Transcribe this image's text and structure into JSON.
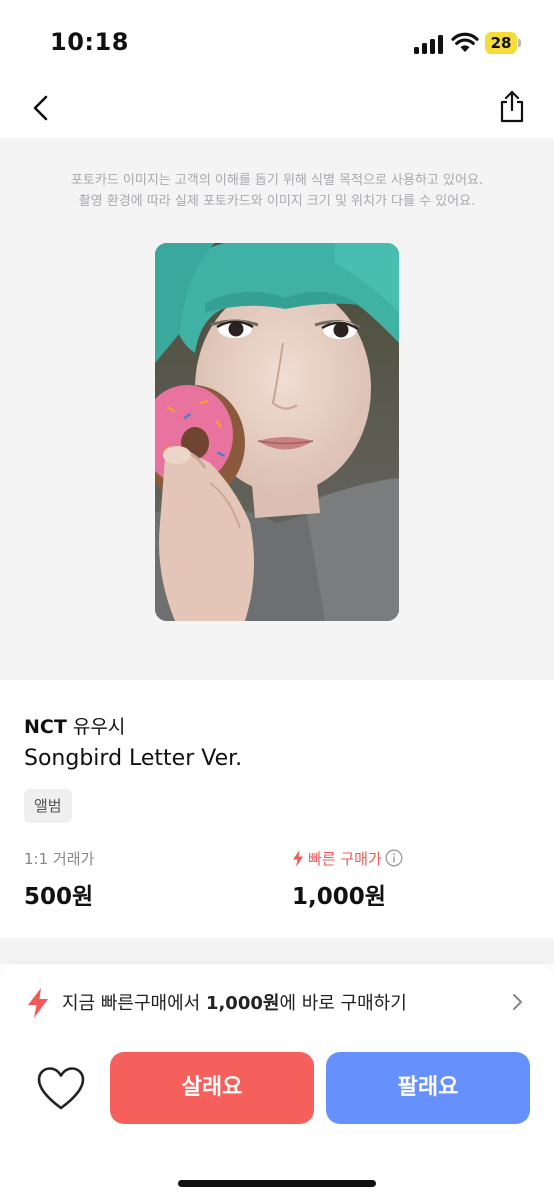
{
  "status_bar": {
    "time": "10:18",
    "battery_level": "28",
    "battery_color": "#f5dc3b"
  },
  "nav": {
    "back_icon": "chevron-left-icon",
    "share_icon": "share-icon"
  },
  "photo": {
    "notice_line1": "포토카드 이미지는 고객의 이해를 돕기 위해 식별 목적으로 사용하고 있어요.",
    "notice_line2": "촬영 환경에 따라 실제 포토카드와 이미지 크기 및 위치가 다를 수 있어요."
  },
  "product": {
    "group": "NCT",
    "member": "유우시",
    "album": "Songbird Letter Ver.",
    "tag": "앨범"
  },
  "prices": {
    "trade_label": "1:1 거래가",
    "trade_value": "500원",
    "fast_label": "빠른 구매가",
    "fast_value": "1,000원",
    "fast_color": "#f05a5a"
  },
  "fast_buy": {
    "prefix": "지금 빠른구매에서 ",
    "amount": "1,000원",
    "suffix": "에 바로 구매하기"
  },
  "actions": {
    "favorite_icon": "heart-icon",
    "buy_label": "살래요",
    "sell_label": "팔래요",
    "buy_color": "#f55f5c",
    "sell_color": "#6690fb"
  }
}
